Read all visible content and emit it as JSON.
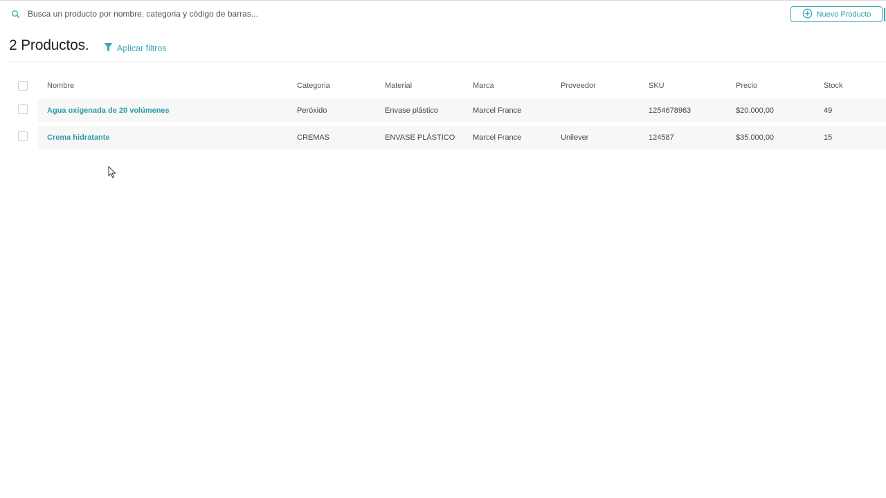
{
  "search": {
    "placeholder": "Busca un producto por nombre, categoria y código de barras..."
  },
  "toolbar": {
    "new_product_label": "Nuevo Producto"
  },
  "header": {
    "title": "2 Productos.",
    "filters_label": "Aplicar filtros"
  },
  "table": {
    "columns": [
      "Nombre",
      "Categoria",
      "Material",
      "Marca",
      "Proveedor",
      "SKU",
      "Precio",
      "Stock"
    ],
    "rows": [
      {
        "nombre": "Agua oxigenada de 20 volúmenes",
        "categoria": "Peróxido",
        "material": "Envase plástico",
        "marca": "Marcel France",
        "proveedor": "",
        "sku": "1254678963",
        "precio": "$20.000,00",
        "stock": "49"
      },
      {
        "nombre": "Crema hidratante",
        "categoria": "CREMAS",
        "material": "ENVASE PLÁSTICO",
        "marca": "Marcel France",
        "proveedor": "Unilever",
        "sku": "124587",
        "precio": "$35.000,00",
        "stock": "15"
      }
    ]
  },
  "colors": {
    "accent": "#3aa9b5",
    "row_background": "#f7f7f7"
  }
}
